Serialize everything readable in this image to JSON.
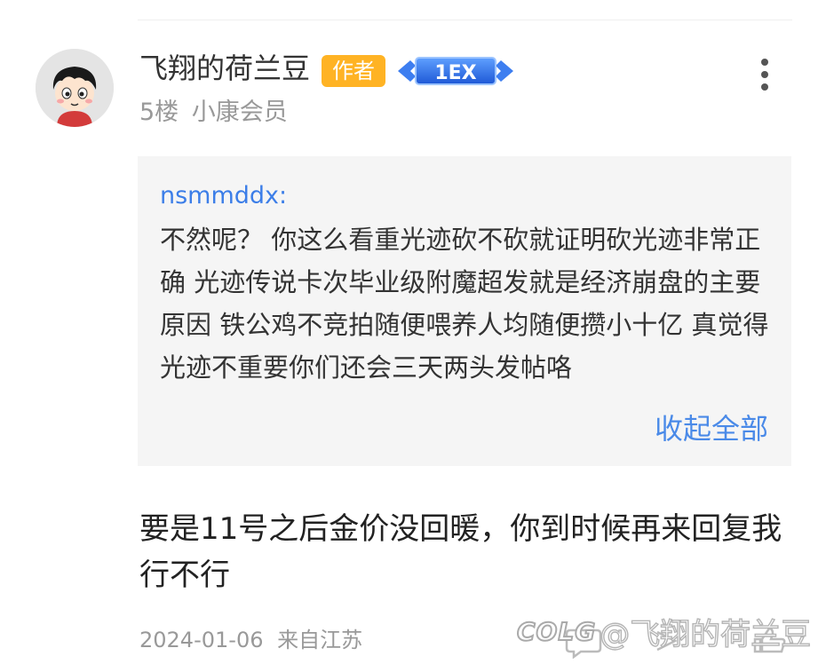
{
  "post": {
    "username": "飞翔的荷兰豆",
    "author_badge": "作者",
    "level_badge": "1EX",
    "floor": "5楼",
    "member_level": "小康会员",
    "date": "2024-01-06",
    "location": "来自江苏",
    "reply_text": "要是11号之后金价没回暖，你到时候再来回复我行不行"
  },
  "quote": {
    "author": "nsmmddx:",
    "text": "不然呢？ 你这么看重光迹砍不砍就证明砍光迹非常正确 光迹传说卡次毕业级附魔超发就是经济崩盘的主要原因 铁公鸡不竞拍随便喂养人均随便攒小十亿 真觉得光迹不重要你们还会三天两头发帖咯",
    "collapse_label": "收起全部"
  },
  "watermark": {
    "logo": "COLG",
    "text": "@飞翔的荷兰豆"
  },
  "colors": {
    "author_badge": "#ffb324",
    "quote_author": "#3c7ee8",
    "collapse_link": "#4a8ae8",
    "quote_background": "#f5f5f5",
    "level_badge": "#2a6de0"
  },
  "icons": {
    "more": "more-vertical-icon",
    "reply": "comment-icon",
    "share": "share-icon",
    "like": "thumb-up-icon"
  }
}
